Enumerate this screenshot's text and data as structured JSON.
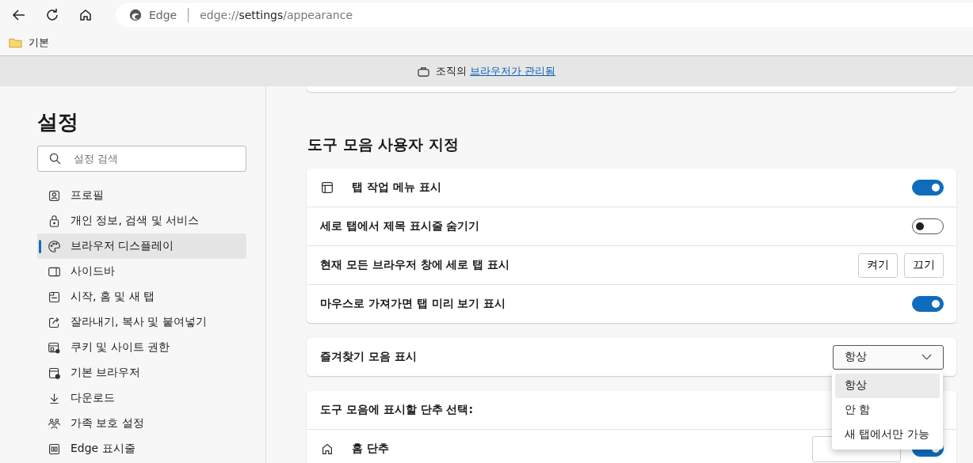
{
  "browser": {
    "brand": "Edge",
    "url_host": "edge://",
    "url_path": "settings",
    "url_rest": "/appearance"
  },
  "bookmarks": [
    {
      "label": "기본"
    }
  ],
  "infobar": {
    "text": "조직의",
    "link": "브라우저가 관리됨"
  },
  "sidebar": {
    "title": "설정",
    "search": {
      "placeholder": "설정 검색"
    },
    "items": [
      {
        "label": "프로필",
        "selected": false
      },
      {
        "label": "개인 정보, 검색 및 서비스",
        "selected": false
      },
      {
        "label": "브라우저 디스플레이",
        "selected": true
      },
      {
        "label": "사이드바",
        "selected": false
      },
      {
        "label": "시작, 홈 및 새 탭",
        "selected": false
      },
      {
        "label": "잘라내기, 복사 및 붙여넣기",
        "selected": false
      },
      {
        "label": "쿠키 및 사이트 권한",
        "selected": false
      },
      {
        "label": "기본 브라우저",
        "selected": false
      },
      {
        "label": "다운로드",
        "selected": false
      },
      {
        "label": "가족 보호 설정",
        "selected": false
      },
      {
        "label": "Edge 표시줄",
        "selected": false
      }
    ]
  },
  "section": {
    "title": "도구 모음 사용자 지정"
  },
  "cards": [
    {
      "rows": [
        {
          "kind": "toggle",
          "label": "탭 작업 메뉴 표시",
          "on": true
        },
        {
          "kind": "toggle",
          "label": "세로 탭에서 제목 표시줄 숨기기",
          "on": false
        },
        {
          "kind": "buttons",
          "label": "현재 모든 브라우저 창에 세로 탭 표시",
          "buttons": [
            "켜기",
            "끄기"
          ]
        },
        {
          "kind": "toggle",
          "label": "마우스로 가져가면 탭 미리 보기 표시",
          "on": true
        }
      ]
    },
    {
      "rows": [
        {
          "kind": "select",
          "label": "즐겨찾기 모음 표시",
          "value": "항상",
          "expanded": true,
          "options": [
            {
              "label": "항상",
              "selected": true
            },
            {
              "label": "안 함",
              "selected": false
            },
            {
              "label": "새 탭에서만 가능",
              "selected": false
            }
          ]
        }
      ]
    },
    {
      "rows": [
        {
          "kind": "header",
          "label": "도구 모음에 표시할 단추 선택:"
        },
        {
          "kind": "toggle-button",
          "label": "홈 단추",
          "on": true
        }
      ]
    }
  ]
}
